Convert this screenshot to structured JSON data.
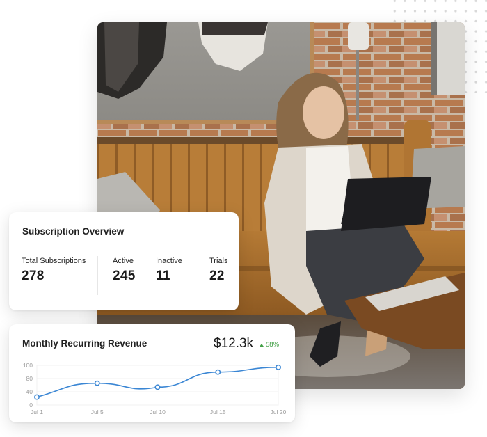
{
  "photo": {
    "alt": "Woman with glasses using a laptop on an orange tufted sofa in a cafe with brick wall and sneaker mural"
  },
  "subscription_overview": {
    "title": "Subscription Overview",
    "stats": [
      {
        "label": "Total Subscriptions",
        "value": "278"
      },
      {
        "label": "Active",
        "value": "245"
      },
      {
        "label": "Inactive",
        "value": "11"
      },
      {
        "label": "Trials",
        "value": "22"
      }
    ]
  },
  "mrr": {
    "title": "Monthly Recurring Revenue",
    "value": "$12.3k",
    "change": "58%",
    "change_direction": "up",
    "colors": {
      "line": "#3a86d4",
      "positive": "#43a047"
    }
  },
  "chart_data": {
    "type": "line",
    "title": "Monthly Recurring Revenue",
    "xlabel": "",
    "ylabel": "",
    "categories": [
      "Jul 1",
      "Jul 5",
      "Jul 10",
      "Jul 15",
      "Jul 20"
    ],
    "y_tick_labels": [
      "0",
      "40",
      "80",
      "100"
    ],
    "ylim": [
      0,
      100
    ],
    "grid": true,
    "smooth": true,
    "series": [
      {
        "name": "MRR",
        "values": [
          20,
          55,
          45,
          83,
          95
        ]
      }
    ]
  }
}
